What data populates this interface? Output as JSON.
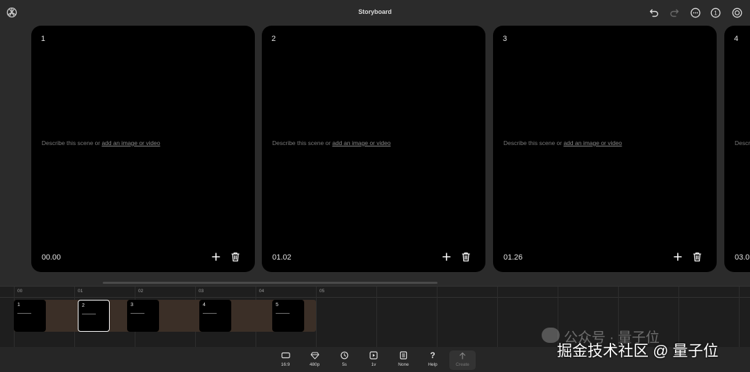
{
  "header": {
    "title": "Storyboard",
    "notification_count": "1"
  },
  "scenes": [
    {
      "number": "1",
      "desc_prefix": "Describe this scene or ",
      "desc_link": "add an image or video",
      "time": "00.00"
    },
    {
      "number": "2",
      "desc_prefix": "Describe this scene or ",
      "desc_link": "add an image or video",
      "time": "01.02"
    },
    {
      "number": "3",
      "desc_prefix": "Describe this scene or ",
      "desc_link": "add an image or video",
      "time": "01.26"
    },
    {
      "number": "4",
      "desc_prefix": "Descr",
      "time": "03.0"
    }
  ],
  "timeline": {
    "ticks": [
      "00",
      "01",
      "02",
      "03",
      "04",
      "05"
    ],
    "clips": [
      {
        "number": "1",
        "selected": false
      },
      {
        "number": "2",
        "selected": true
      },
      {
        "number": "3",
        "selected": false
      },
      {
        "number": "4",
        "selected": false
      },
      {
        "number": "5",
        "selected": false
      }
    ]
  },
  "toolbar": {
    "aspect": "16:9",
    "resolution": "480p",
    "duration": "5s",
    "variations": "1v",
    "preset": "None",
    "help": "Help",
    "create": "Create"
  },
  "watermark": {
    "line1": "公众号 · 量子位",
    "line2": "掘金技术社区 @ 量子位"
  },
  "colors": {
    "background": "#2b2b2b",
    "card": "#000000",
    "timeline_strip": "#3b2f27"
  }
}
